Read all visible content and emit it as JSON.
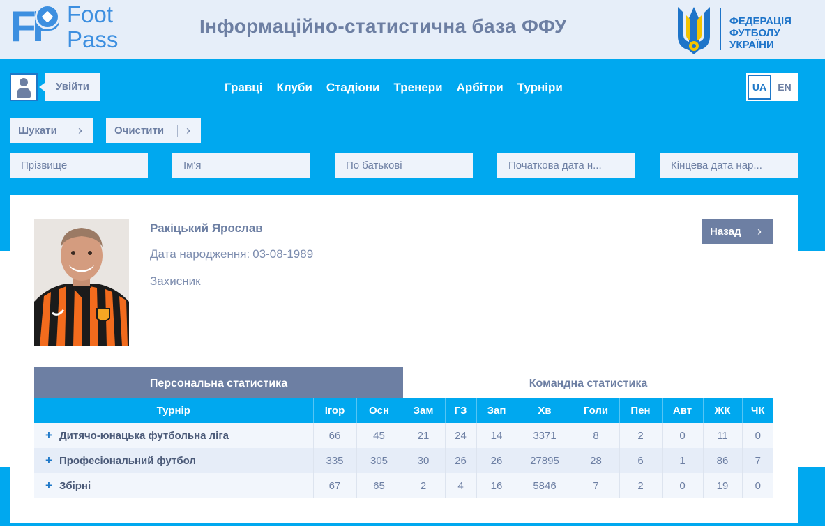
{
  "header": {
    "logo_line1": "Foot",
    "logo_line2": "Pass",
    "logo_mark": "FP",
    "site_title": "Інформаційно-статистична база ФФУ",
    "ffu_line1": "ФЕДЕРАЦІЯ",
    "ffu_line2": "ФУТБОЛУ",
    "ffu_line3": "УКРАЇНИ"
  },
  "auth": {
    "user_icon": "user-icon",
    "login_label": "Увійти"
  },
  "nav": {
    "items": [
      "Гравці",
      "Клуби",
      "Стадіони",
      "Тренери",
      "Арбітри",
      "Турніри"
    ]
  },
  "lang": {
    "ua": "UA",
    "en": "EN",
    "active": "UA"
  },
  "search": {
    "search_label": "Шукати",
    "clear_label": "Очистити",
    "fields": {
      "surname": "Прізвище",
      "name": "Ім'я",
      "patronymic": "По батькові",
      "dob_from": "Початкова дата н...",
      "dob_to": "Кінцева дата нар..."
    }
  },
  "player": {
    "name": "Ракіцький Ярослав",
    "dob_label": "Дата народження:",
    "dob": "03-08-1989",
    "position": "Захисник",
    "back_label": "Назад"
  },
  "stats": {
    "tabs": {
      "personal": "Персональна статистика",
      "team": "Командна статистика",
      "active": "personal"
    },
    "columns": [
      "Турнір",
      "Ігор",
      "Осн",
      "Зам",
      "ГЗ",
      "Зап",
      "Хв",
      "Голи",
      "Пен",
      "Авт",
      "ЖК",
      "ЧК"
    ],
    "rows": [
      {
        "tournament": "Дитячо-юнацька футбольна ліга",
        "values": [
          "66",
          "45",
          "21",
          "24",
          "14",
          "3371",
          "8",
          "2",
          "0",
          "11",
          "0"
        ]
      },
      {
        "tournament": "Професіональний футбол",
        "values": [
          "335",
          "305",
          "30",
          "26",
          "26",
          "27895",
          "28",
          "6",
          "1",
          "86",
          "7"
        ]
      },
      {
        "tournament": "Збірні",
        "values": [
          "67",
          "65",
          "2",
          "4",
          "16",
          "5846",
          "7",
          "2",
          "0",
          "19",
          "0"
        ]
      }
    ]
  },
  "colors": {
    "accent": "#00a8ef",
    "slate": "#6d7fa3",
    "header_bg": "#e6eef9",
    "ffu_blue": "#1e74c9",
    "ffu_yellow": "#f5c400"
  }
}
